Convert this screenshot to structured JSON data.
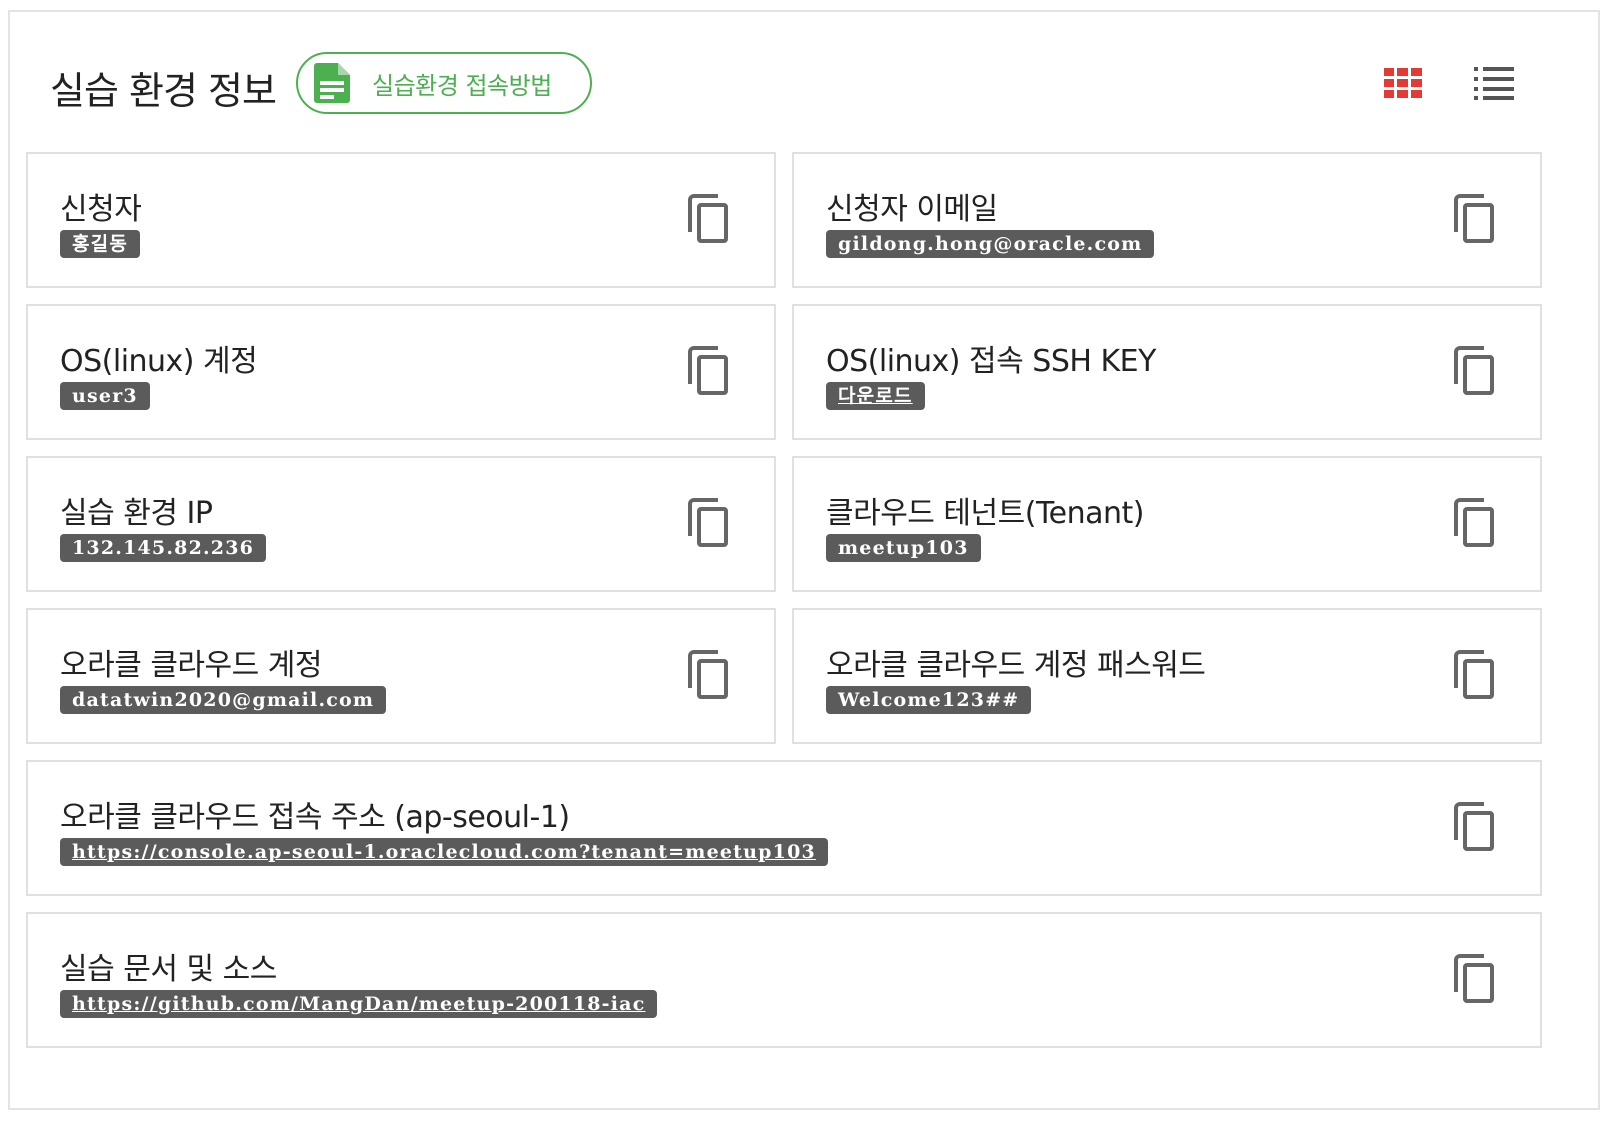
{
  "header": {
    "title": "실습 환경 정보",
    "guide_button_label": "실습환경 접속방법",
    "accent_color": "#4caf50",
    "grid_icon_color": "#e53935"
  },
  "cards": [
    {
      "title": "신청자",
      "value": "홍길동"
    },
    {
      "title": "신청자 이메일",
      "value": "gildong.hong@oracle.com"
    },
    {
      "title": "OS(linux) 계정",
      "value": "user3"
    },
    {
      "title": "OS(linux) 접속 SSH KEY",
      "value": "다운로드"
    },
    {
      "title": "실습 환경 IP",
      "value": "132.145.82.236"
    },
    {
      "title": "클라우드 테넌트(Tenant)",
      "value": "meetup103"
    },
    {
      "title": "오라클 클라우드 계정",
      "value": "datatwin2020@gmail.com"
    },
    {
      "title": "오라클 클라우드 계정 패스워드",
      "value": "Welcome123##"
    },
    {
      "title": "오라클 클라우드 접속 주소 (ap-seoul-1)",
      "value": "https://console.ap-seoul-1.oraclecloud.com?tenant=meetup103"
    },
    {
      "title": "실습 문서 및 소스",
      "value": "https://github.com/MangDan/meetup-200118-iac"
    }
  ]
}
